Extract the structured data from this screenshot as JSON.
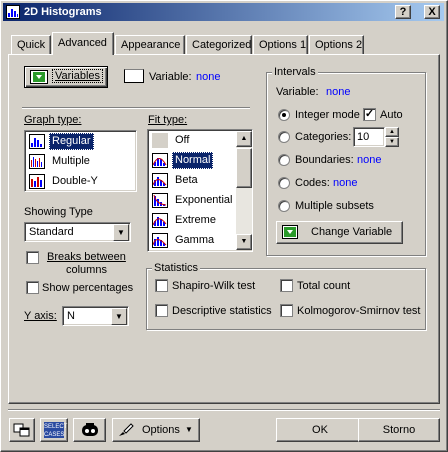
{
  "window": {
    "title": "2D Histograms",
    "help_label": "?",
    "close_label": "X"
  },
  "tabs": [
    {
      "label": "Quick"
    },
    {
      "label": "Advanced"
    },
    {
      "label": "Appearance"
    },
    {
      "label": "Categorized"
    },
    {
      "label": "Options 1"
    },
    {
      "label": "Options 2"
    }
  ],
  "variables": {
    "button_label": "Variables",
    "variable_label": "Variable:",
    "variable_value": "none"
  },
  "graph_type": {
    "label": "Graph type:",
    "items": [
      {
        "label": "Regular",
        "selected": true
      },
      {
        "label": "Multiple",
        "selected": false
      },
      {
        "label": "Double-Y",
        "selected": false
      }
    ]
  },
  "fit_type": {
    "label": "Fit type:",
    "items": [
      {
        "label": "Off",
        "selected": false
      },
      {
        "label": "Normal",
        "selected": true
      },
      {
        "label": "Beta",
        "selected": false
      },
      {
        "label": "Exponential",
        "selected": false
      },
      {
        "label": "Extreme",
        "selected": false
      },
      {
        "label": "Gamma",
        "selected": false
      }
    ]
  },
  "showing_type": {
    "label": "Showing Type",
    "value": "Standard"
  },
  "options": {
    "breaks_between_columns": "Breaks between columns",
    "breaks_line1": "Breaks between",
    "breaks_line2": "columns",
    "show_percentages": "Show percentages",
    "y_axis_label": "Y axis:",
    "y_axis_value": "N"
  },
  "intervals": {
    "title": "Intervals",
    "variable_label": "Variable:",
    "variable_value": "none",
    "integer_mode": "Integer mode",
    "auto": "Auto",
    "categories": "Categories:",
    "categories_value": "10",
    "boundaries": "Boundaries:",
    "boundaries_value": "none",
    "codes": "Codes:",
    "codes_value": "none",
    "multiple_subsets": "Multiple subsets",
    "change_variable": "Change Variable"
  },
  "statistics": {
    "title": "Statistics",
    "shapiro_wilk": "Shapiro-Wilk test",
    "total_count": "Total count",
    "descriptive": "Descriptive statistics",
    "kolmogorov": "Kolmogorov-Smirnov test"
  },
  "bottom": {
    "select_cases_line1": "SELECT",
    "select_cases_line2": "CASES",
    "options_label": "Options",
    "ok_label": "OK",
    "cancel_label": "Storno"
  }
}
